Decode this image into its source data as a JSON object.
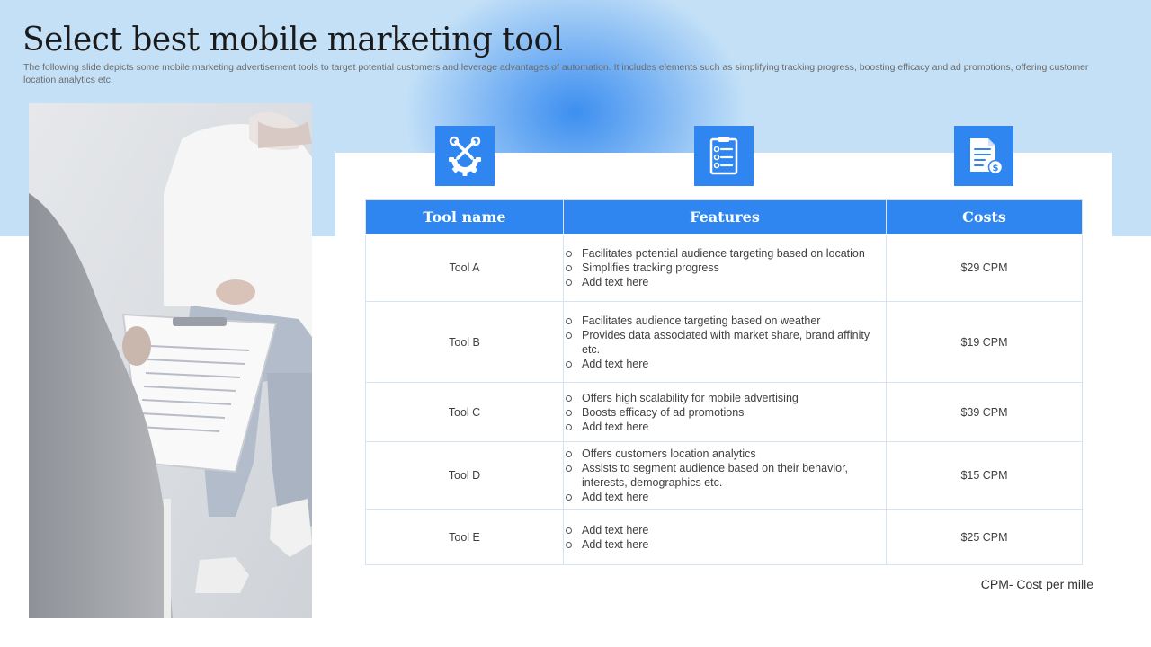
{
  "header": {
    "title": "Select best mobile marketing tool",
    "subtitle": "The following slide depicts some mobile marketing advertisement tools to target potential customers and leverage advantages of automation. It includes elements such as simplifying tracking progress, boosting efficacy and ad promotions, offering customer location analytics etc."
  },
  "icons": [
    "tools-gear-icon",
    "checklist-clipboard-icon",
    "cost-document-icon"
  ],
  "table": {
    "columns": [
      "Tool name",
      "Features",
      "Costs"
    ],
    "rows": [
      {
        "name": "Tool A",
        "features": [
          "Facilitates potential audience targeting based on location",
          "Simplifies tracking progress",
          "Add text here"
        ],
        "cost": "$29 CPM"
      },
      {
        "name": "Tool B",
        "features": [
          "Facilitates audience targeting based on weather",
          "Provides data associated with market share, brand affinity etc.",
          "Add text here"
        ],
        "cost": "$19 CPM"
      },
      {
        "name": "Tool C",
        "features": [
          "Offers high scalability for mobile advertising",
          "Boosts efficacy of ad promotions",
          "Add text here"
        ],
        "cost": "$39 CPM"
      },
      {
        "name": "Tool D",
        "features": [
          "Offers customers location analytics",
          "Assists to segment audience based on their behavior, interests, demographics etc.",
          "Add text here"
        ],
        "cost": "$15 CPM"
      },
      {
        "name": "Tool E",
        "features": [
          "Add text here",
          "Add text here"
        ],
        "cost": "$25 CPM"
      }
    ]
  },
  "footnote": "CPM- Cost per mille",
  "colors": {
    "accent": "#2f86f0",
    "band": "#c3e0f7",
    "title": "#1a1a1a"
  }
}
